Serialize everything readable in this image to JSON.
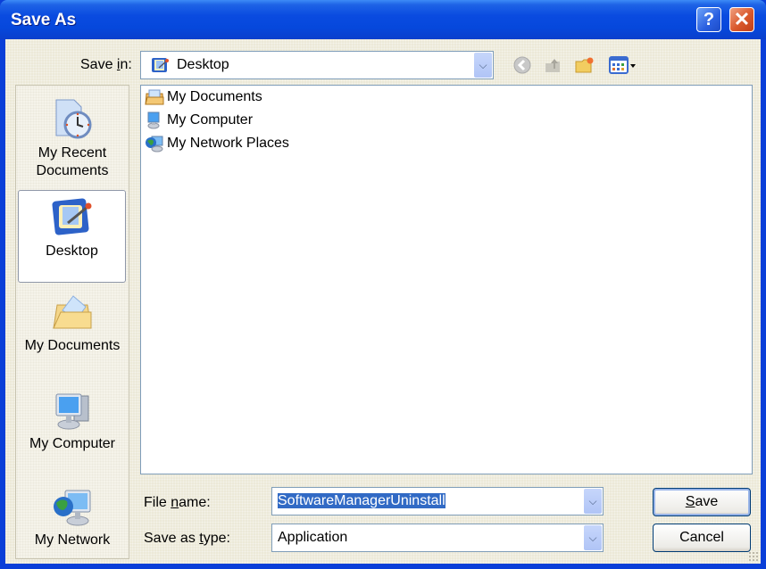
{
  "window": {
    "title": "Save As",
    "help_button": "?",
    "close_button": "✕"
  },
  "toolbar": {
    "save_in_label_pre": "Save ",
    "save_in_label_u": "i",
    "save_in_label_post": "n:",
    "save_in_value": "Desktop",
    "save_in_icon": "desktop-icon",
    "tools": [
      {
        "name": "back-icon"
      },
      {
        "name": "up-folder-icon"
      },
      {
        "name": "new-folder-icon"
      },
      {
        "name": "views-menu-icon"
      }
    ]
  },
  "places": [
    {
      "label_line1": "My Recent",
      "label_line2": "Documents",
      "icon": "recent-documents-icon",
      "selected": false
    },
    {
      "label_line1": "Desktop",
      "label_line2": "",
      "icon": "desktop-icon",
      "selected": true
    },
    {
      "label_line1": "My Documents",
      "label_line2": "",
      "icon": "my-documents-icon",
      "selected": false
    },
    {
      "label_line1": "My Computer",
      "label_line2": "",
      "icon": "my-computer-icon",
      "selected": false
    },
    {
      "label_line1": "My Network",
      "label_line2": "",
      "icon": "my-network-icon",
      "selected": false
    }
  ],
  "files": [
    {
      "label": "My Documents",
      "icon": "my-documents-icon"
    },
    {
      "label": "My Computer",
      "icon": "my-computer-icon"
    },
    {
      "label": "My Network Places",
      "icon": "my-network-places-icon"
    }
  ],
  "form": {
    "file_name_label_pre": "File ",
    "file_name_label_u": "n",
    "file_name_label_post": "ame:",
    "file_name_value": "SoftwareManagerUninstall",
    "save_type_label_pre": "Save as ",
    "save_type_label_u": "t",
    "save_type_label_post": "ype:",
    "save_type_value": "Application"
  },
  "buttons": {
    "save_u": "S",
    "save_rest": "ave",
    "cancel": "Cancel"
  },
  "colors": {
    "titlebar": "#0a4be0",
    "selection": "#316ac5",
    "close": "#d9582c"
  }
}
